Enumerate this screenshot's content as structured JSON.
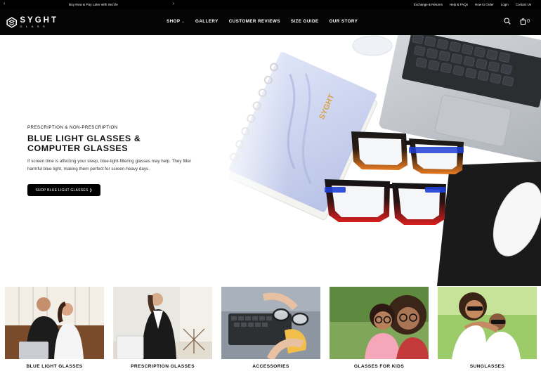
{
  "announcement": {
    "message": "Buy Now & Pay Later with Sezzle",
    "prev_icon": "chevron-left-icon",
    "next_icon": "chevron-right-icon",
    "links": [
      "Exchange & Returns",
      "Help & FAQs",
      "How to Order",
      "Login",
      "Contact Us"
    ]
  },
  "header": {
    "logo_word": "SYGHT",
    "logo_sub": "GLASS",
    "nav": [
      {
        "label": "SHOP",
        "has_dropdown": true
      },
      {
        "label": "GALLERY"
      },
      {
        "label": "CUSTOMER REVIEWS"
      },
      {
        "label": "SIZE GUIDE"
      },
      {
        "label": "OUR STORY"
      }
    ],
    "search_icon": "search-icon",
    "cart_icon": "bag-icon",
    "cart_count": "0"
  },
  "hero": {
    "eyebrow": "PRESCRIPTION & NON-PRESCRIPTION",
    "title": "BLUE LIGHT GLASSES & COMPUTER GLASSES",
    "body": "If screen time is affecting your sleep, blue-light-filtering glasses may help. They filter harmful blue light, making them perfect for screen-heavy days.",
    "cta": "SHOP BLUE LIGHT GLASSES ❯",
    "notebook_text": "SYGHT"
  },
  "categories": [
    {
      "label": "BLUE LIGHT GLASSES"
    },
    {
      "label": "PRESCRIPTION GLASSES"
    },
    {
      "label": "ACCESSORIES"
    },
    {
      "label": "GLASSES FOR KIDS"
    },
    {
      "label": "SUNGLASSES"
    }
  ],
  "colors": {
    "header_bg": "#050505",
    "accent_black": "#000000",
    "frame_orange": "#e0761f",
    "frame_red": "#d21f1f",
    "frame_blue": "#1f3fd6"
  }
}
